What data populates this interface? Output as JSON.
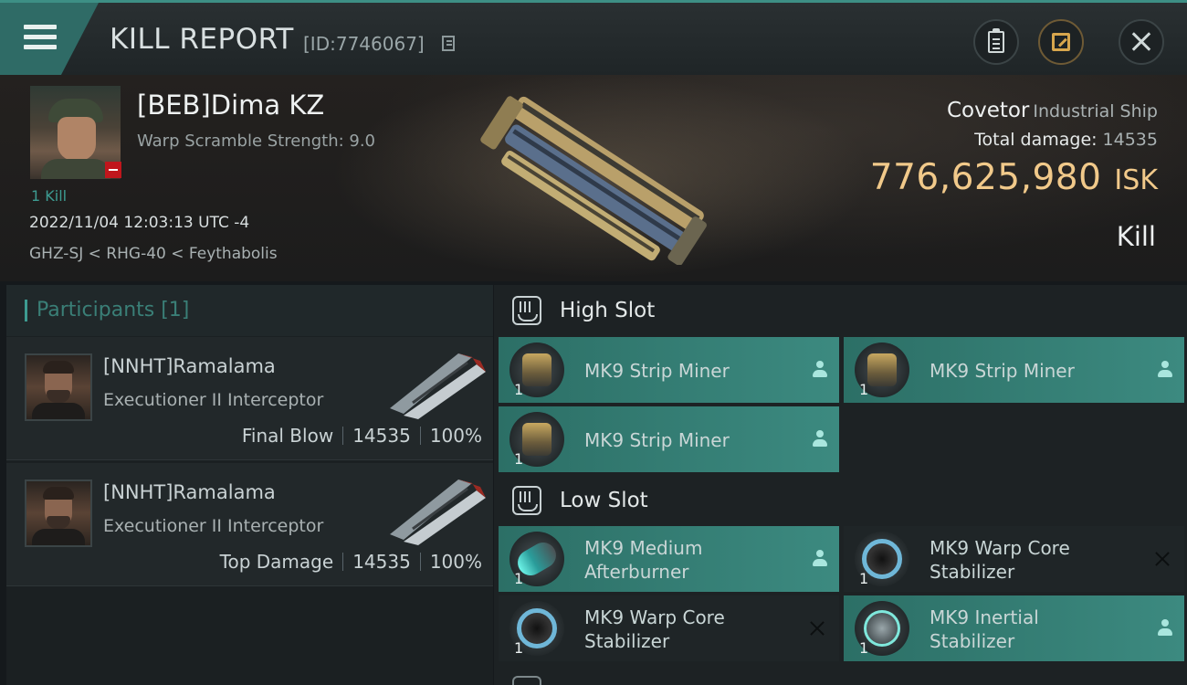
{
  "header": {
    "title": "KILL REPORT",
    "id_text": "[ID:7746067]"
  },
  "victim": {
    "name": "[BEB]Dima KZ",
    "warp_scramble": "Warp Scramble Strength: 9.0",
    "kills": "1 Kill",
    "datetime": "2022/11/04 12:03:13 UTC -4",
    "location": "GHZ-SJ < RHG-40 < Feythabolis",
    "ship_name": "Covetor",
    "ship_class": "Industrial Ship",
    "total_damage_label": "Total damage:",
    "total_damage_value": "14535",
    "isk_value": "776,625,980",
    "isk_unit": "ISK",
    "result": "Kill"
  },
  "participants": {
    "header": "Participants [1]",
    "items": [
      {
        "name": "[NNHT]Ramalama",
        "ship": "Executioner II Interceptor",
        "role": "Final Blow",
        "damage": "14535",
        "percent": "100%"
      },
      {
        "name": "[NNHT]Ramalama",
        "ship": "Executioner II Interceptor",
        "role": "Top Damage",
        "damage": "14535",
        "percent": "100%"
      }
    ]
  },
  "fittings": {
    "high_slot": {
      "title": "High Slot",
      "modules": [
        {
          "name_line1": "MK9 Strip Miner",
          "name_line2": "",
          "qty": "1",
          "status": "dropped",
          "icon": "strip-miner-icon"
        },
        {
          "name_line1": "MK9 Strip Miner",
          "name_line2": "",
          "qty": "1",
          "status": "dropped",
          "icon": "strip-miner-icon"
        },
        {
          "name_line1": "MK9 Strip Miner",
          "name_line2": "",
          "qty": "1",
          "status": "dropped",
          "icon": "strip-miner-icon"
        }
      ]
    },
    "low_slot": {
      "title": "Low Slot",
      "modules": [
        {
          "name_line1": "MK9 Medium",
          "name_line2": "Afterburner",
          "qty": "1",
          "status": "dropped",
          "icon": "afterburner-icon"
        },
        {
          "name_line1": "MK9 Warp Core",
          "name_line2": "Stabilizer",
          "qty": "1",
          "status": "destroyed",
          "icon": "warp-core-stabilizer-icon"
        },
        {
          "name_line1": "MK9 Warp Core",
          "name_line2": "Stabilizer",
          "qty": "1",
          "status": "destroyed",
          "icon": "warp-core-stabilizer-icon"
        },
        {
          "name_line1": "MK9 Inertial",
          "name_line2": "Stabilizer",
          "qty": "1",
          "status": "dropped",
          "icon": "inertial-stabilizer-icon"
        }
      ]
    }
  },
  "colors": {
    "accent": "#3d9b91",
    "isk": "#f1c98a",
    "module_dropped": "#3c8a80",
    "destroyed_badge": "#c0161c"
  }
}
